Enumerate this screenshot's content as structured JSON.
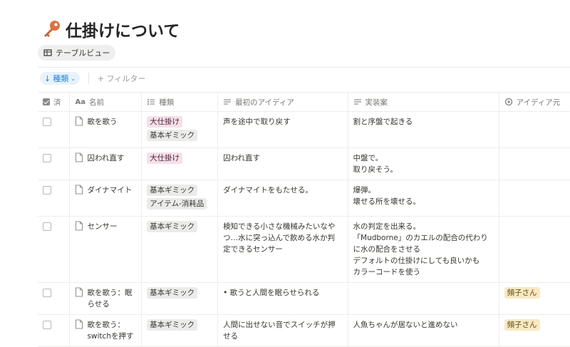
{
  "page": {
    "title": "仕掛けについて",
    "icon": "key-icon"
  },
  "view": {
    "label": "テーブルビュー",
    "icon": "table-icon"
  },
  "toolbar": {
    "sort_label": "種類",
    "filter_label": "+ フィルター"
  },
  "table": {
    "columns": [
      {
        "label": "済",
        "icon": "checkbox-icon"
      },
      {
        "label": "名前",
        "icon": "text-type-icon"
      },
      {
        "label": "種類",
        "icon": "list-icon"
      },
      {
        "label": "最初のアイディア",
        "icon": "text-lines-icon"
      },
      {
        "label": "実装案",
        "icon": "text-lines-icon"
      },
      {
        "label": "アイディア元",
        "icon": "select-icon"
      }
    ],
    "rows": [
      {
        "name": "歌を歌う",
        "tags": [
          {
            "text": "大仕掛け",
            "color": "pink"
          },
          {
            "text": "基本ギミック",
            "color": "gray"
          }
        ],
        "idea": "声を途中で取り戻す",
        "impl": "割と序盤で起きる",
        "source": ""
      },
      {
        "name": "囚われ直す",
        "tags": [
          {
            "text": "大仕掛け",
            "color": "pink"
          }
        ],
        "idea": "囚われ直す",
        "impl": "中盤で。\n取り戻そう。",
        "source": ""
      },
      {
        "name": "ダイナマイト",
        "tags": [
          {
            "text": "基本ギミック",
            "color": "gray"
          },
          {
            "text": "アイテム-消耗品",
            "color": "gray"
          }
        ],
        "idea": "ダイナマイトをもたせる。",
        "impl": "爆弾。\n壊せる所を壊せる。",
        "source": ""
      },
      {
        "name": "センサー",
        "tags": [
          {
            "text": "基本ギミック",
            "color": "gray"
          }
        ],
        "idea": "検知できる小さな機械みたいなやつ…水に突っ込んで飲める水か判定できるセンサー",
        "impl": "水の判定を出来る。\n「Mudborne」のカエルの配合の代わりに水の配合をさせる\nデフォルトの仕掛けにしても良いかも\nカラーコードを使う",
        "source": ""
      },
      {
        "name": "歌を歌う：眠らせる",
        "tags": [
          {
            "text": "基本ギミック",
            "color": "gray"
          }
        ],
        "idea": "• 歌うと人間を眠らせられる",
        "impl": "",
        "source": "頻子さん"
      },
      {
        "name": "歌を歌う：switchを押す",
        "tags": [
          {
            "text": "基本ギミック",
            "color": "gray"
          }
        ],
        "idea": "人間に出せない音でスイッチが押せる",
        "impl": "人魚ちゃんが居ないと進めない",
        "source": "頻子さん"
      }
    ]
  }
}
